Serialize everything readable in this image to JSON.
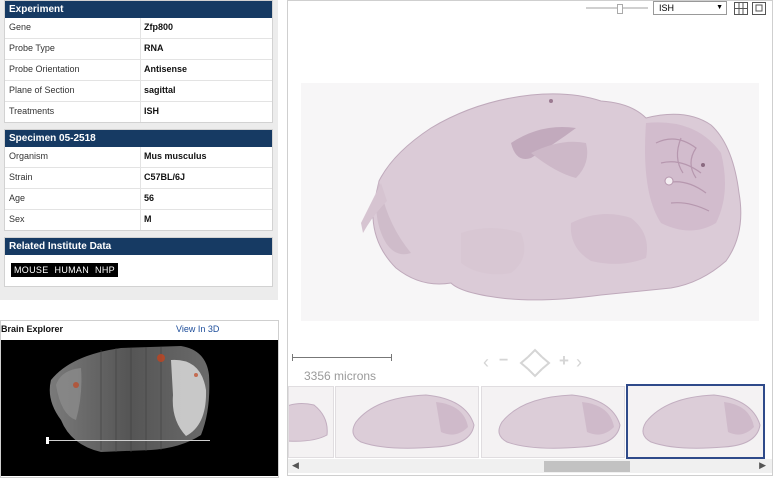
{
  "experiment": {
    "title": "Experiment",
    "rows": [
      {
        "key": "Gene",
        "value": "Zfp800"
      },
      {
        "key": "Probe Type",
        "value": "RNA"
      },
      {
        "key": "Probe Orientation",
        "value": "Antisense"
      },
      {
        "key": "Plane of Section",
        "value": "sagittal"
      },
      {
        "key": "Treatments",
        "value": "ISH"
      }
    ]
  },
  "specimen": {
    "title": "Specimen 05-2518",
    "rows": [
      {
        "key": "Organism",
        "value": "Mus musculus"
      },
      {
        "key": "Strain",
        "value": "C57BL/6J"
      },
      {
        "key": "Age",
        "value": "56"
      },
      {
        "key": "Sex",
        "value": "M"
      }
    ]
  },
  "related": {
    "title": "Related Institute Data",
    "links": [
      "MOUSE",
      "HUMAN",
      "NHP"
    ]
  },
  "brain_explorer": {
    "title": "Brain Explorer",
    "view_link": "View In 3D"
  },
  "viewer": {
    "stain_select": "ISH",
    "scale_label": "3356 microns",
    "icons": [
      "grid-view-icon",
      "expand-icon",
      "pan-left-icon",
      "zoom-out-icon",
      "pan-icon",
      "zoom-in-icon",
      "pan-right-icon"
    ],
    "colors": {
      "header": "#163a63",
      "selected_border": "#2f4a8a",
      "tissue": "#c9b6c6"
    }
  }
}
